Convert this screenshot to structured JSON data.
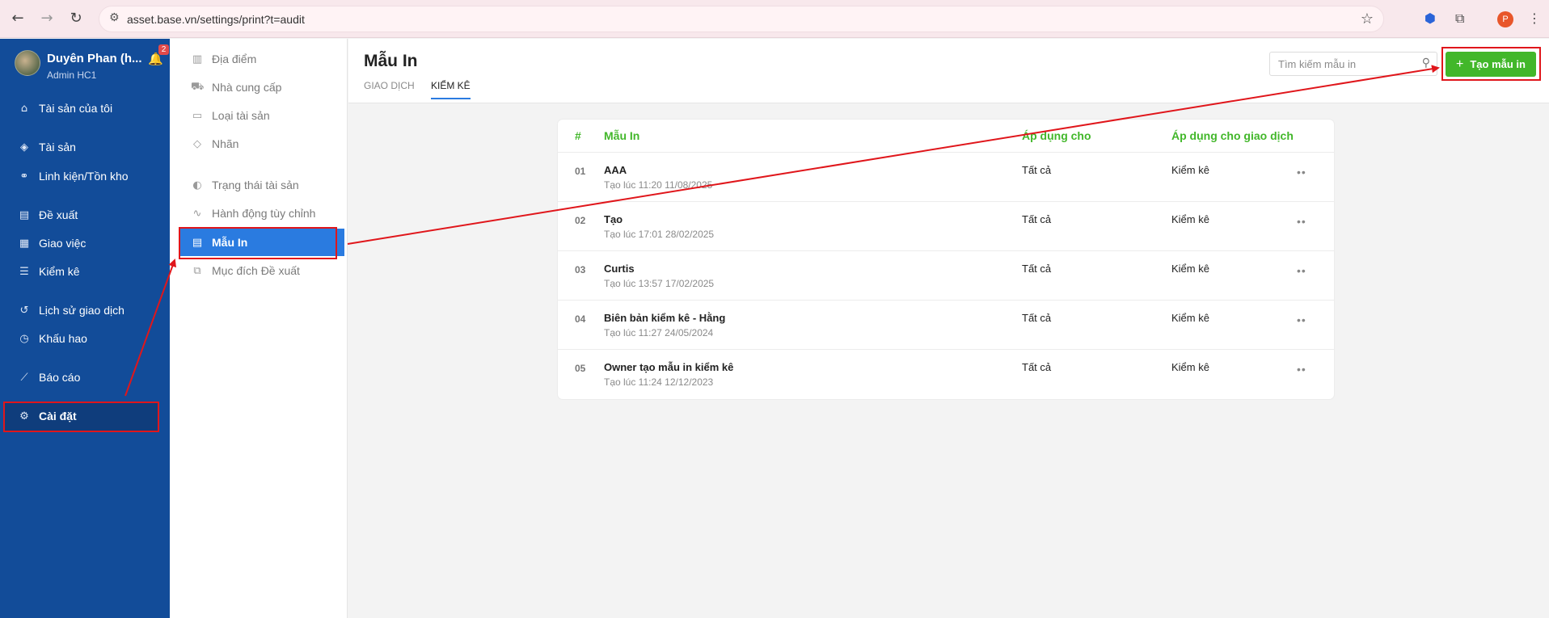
{
  "browser": {
    "url": "asset.base.vn/settings/print?t=audit",
    "profile_initial": "P"
  },
  "sidebar": {
    "user_name": "Duyên Phan (h...",
    "user_role": "Admin HC1",
    "notif_count": "2",
    "items": [
      {
        "label": "Tài sản của tôi",
        "icon": "home-icon"
      },
      {
        "label": "Tài sản",
        "icon": "cube-icon"
      },
      {
        "label": "Linh kiện/Tồn kho",
        "icon": "components-icon"
      },
      {
        "label": "Đề xuất",
        "icon": "document-icon"
      },
      {
        "label": "Giao việc",
        "icon": "clipboard-icon"
      },
      {
        "label": "Kiểm kê",
        "icon": "checklist-icon"
      },
      {
        "label": "Lịch sử giao dịch",
        "icon": "history-icon"
      },
      {
        "label": "Khấu hao",
        "icon": "clock-icon"
      },
      {
        "label": "Báo cáo",
        "icon": "chart-icon"
      },
      {
        "label": "Cài đặt",
        "icon": "gear-icon"
      }
    ]
  },
  "submenu": {
    "items": [
      {
        "label": "Địa điểm",
        "icon": "building-icon"
      },
      {
        "label": "Nhà cung cấp",
        "icon": "truck-icon"
      },
      {
        "label": "Loại tài sản",
        "icon": "folder-icon"
      },
      {
        "label": "Nhãn",
        "icon": "tag-icon"
      },
      {
        "label": "Trạng thái tài sản",
        "icon": "half-circle-icon"
      },
      {
        "label": "Hành động tùy chỉnh",
        "icon": "pulse-icon"
      },
      {
        "label": "Mẫu In",
        "icon": "print-template-icon"
      },
      {
        "label": "Mục đích Đề xuất",
        "icon": "stack-icon"
      }
    ]
  },
  "main": {
    "title": "Mẫu In",
    "tabs": [
      "GIAO DỊCH",
      "KIỂM KÊ"
    ],
    "search_placeholder": "Tìm kiếm mẫu in",
    "create_label": "Tạo mẫu in"
  },
  "table": {
    "headers": [
      "#",
      "Mẫu In",
      "Áp dụng cho",
      "Áp dụng cho giao dịch"
    ],
    "rows": [
      {
        "idx": "01",
        "name": "AAA",
        "created": "Tạo lúc 11:20 11/08/2025",
        "apply": "Tất cả",
        "transaction": "Kiểm kê"
      },
      {
        "idx": "02",
        "name": "Tạo",
        "created": "Tạo lúc 17:01 28/02/2025",
        "apply": "Tất cả",
        "transaction": "Kiểm kê"
      },
      {
        "idx": "03",
        "name": "Curtis",
        "created": "Tạo lúc 13:57 17/02/2025",
        "apply": "Tất cả",
        "transaction": "Kiểm kê"
      },
      {
        "idx": "04",
        "name": "Biên bản kiểm kê - Hằng",
        "created": "Tạo lúc 11:27 24/05/2024",
        "apply": "Tất cả",
        "transaction": "Kiểm kê"
      },
      {
        "idx": "05",
        "name": "Owner tạo mẫu in kiểm kê",
        "created": "Tạo lúc 11:24 12/12/2023",
        "apply": "Tất cả",
        "transaction": "Kiểm kê"
      }
    ]
  },
  "colors": {
    "sidebar": "#124c99",
    "accent": "#2a7be0",
    "green": "#42b72a",
    "annotation": "#e0161b"
  }
}
